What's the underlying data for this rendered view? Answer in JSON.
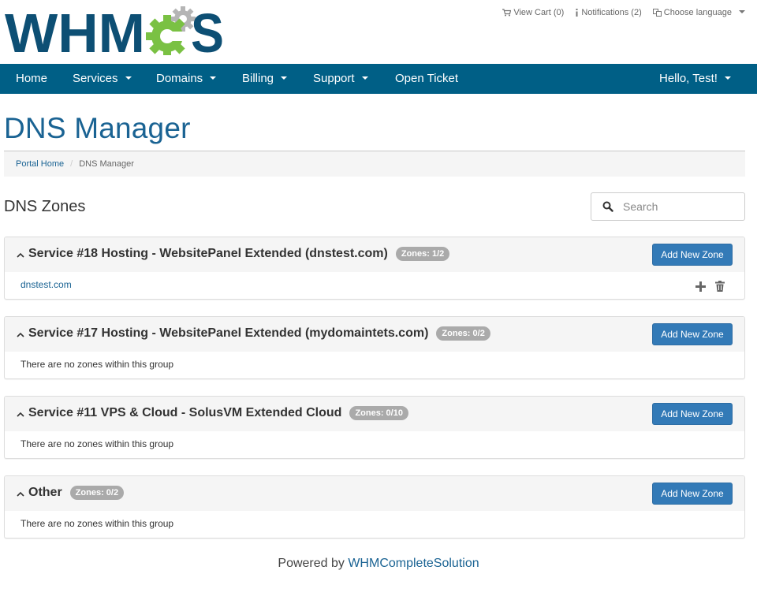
{
  "header": {
    "logo_text": "WHMCS",
    "top_links": {
      "cart": "View Cart (0)",
      "notifications": "Notifications (2)",
      "language": "Choose language"
    }
  },
  "navbar": {
    "home": "Home",
    "services": "Services",
    "domains": "Domains",
    "billing": "Billing",
    "support": "Support",
    "open_ticket": "Open Ticket",
    "user": "Hello, Test!"
  },
  "page": {
    "title": "DNS Manager",
    "breadcrumb": {
      "home": "Portal Home",
      "current": "DNS Manager"
    },
    "zones_heading": "DNS Zones",
    "search_placeholder": "Search"
  },
  "groups": [
    {
      "title": "Service #18 Hosting - WebsitePanel Extended (dnstest.com)",
      "badge": "Zones: 1/2",
      "button": "Add New Zone",
      "zones": [
        "dnstest.com"
      ],
      "empty_text": ""
    },
    {
      "title": "Service #17 Hosting - WebsitePanel Extended (mydomaintets.com)",
      "badge": "Zones: 0/2",
      "button": "Add New Zone",
      "zones": [],
      "empty_text": "There are no zones within this group"
    },
    {
      "title": "Service #11 VPS & Cloud - SolusVM Extended Cloud",
      "badge": "Zones: 0/10",
      "button": "Add New Zone",
      "zones": [],
      "empty_text": "There are no zones within this group"
    },
    {
      "title": "Other",
      "badge": "Zones: 0/2",
      "button": "Add New Zone",
      "zones": [],
      "empty_text": "There are no zones within this group"
    }
  ],
  "footer": {
    "prefix": "Powered by ",
    "link": "WHMCompleteSolution"
  },
  "colors": {
    "navbar": "#005f86",
    "logo_blue": "#0d4f74",
    "logo_green": "#7ac143",
    "link": "#1a6393",
    "button": "#337ab7",
    "badge": "#aaaaaa"
  },
  "icons": {
    "cart": "cart-icon",
    "notifications": "info-icon",
    "language": "language-icon",
    "search": "search-icon",
    "collapse": "chevron-up-icon",
    "add_record": "plus-icon",
    "delete": "trash-icon"
  }
}
